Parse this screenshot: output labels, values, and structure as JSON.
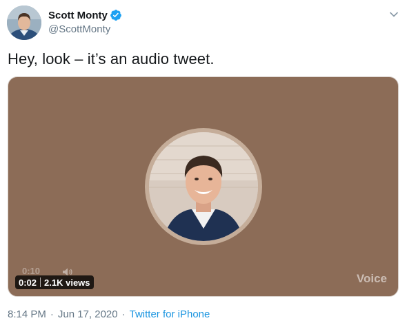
{
  "author": {
    "name": "Scott Monty",
    "handle": "@ScottMonty",
    "verified": true
  },
  "tweet": {
    "text": "Hey, look – it’s an audio tweet."
  },
  "media": {
    "elapsed": "0:02",
    "views": "2.1K views",
    "ghost_time": "0:10",
    "label": "Voice",
    "background_color": "#8c6c57"
  },
  "footer": {
    "time": "8:14 PM",
    "date": "Jun 17, 2020",
    "source": "Twitter for iPhone",
    "separator": "·"
  },
  "colors": {
    "verified_blue": "#1da1f2",
    "link_blue": "#1b95e0",
    "secondary_text": "#657786"
  },
  "icons": [
    "avatar-image",
    "verified-badge-icon",
    "chevron-down-icon",
    "volume-icon"
  ]
}
